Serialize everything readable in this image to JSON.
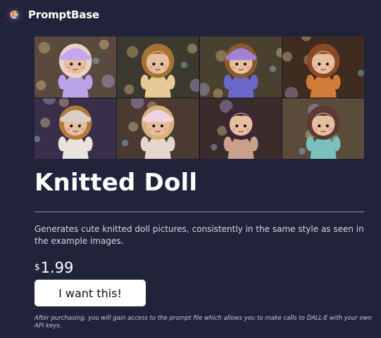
{
  "header": {
    "brand": "PromptBase",
    "logo_icon": "promptbase-brain-logo-icon"
  },
  "gallery": {
    "images": [
      {
        "name": "lavender-doll-image",
        "bg": "#5a4a3e",
        "body": "#b9a3e6",
        "hair": "#e8d2c8",
        "hat": "#c6a6ee"
      },
      {
        "name": "blonde-doll-image",
        "bg": "#3c3a2e",
        "body": "#e7c995",
        "hair": "#a77335",
        "hat": ""
      },
      {
        "name": "purple-hat-doll-image",
        "bg": "#4a4030",
        "body": "#6a67c9",
        "hair": "#8a5a2a",
        "hat": "#9e82d6"
      },
      {
        "name": "orange-doll-image",
        "bg": "#3e2c20",
        "body": "#d27c3a",
        "hair": "#8b4a25",
        "hat": ""
      },
      {
        "name": "beige-hat-doll-image",
        "bg": "#3a2f4a",
        "body": "#e9e3dc",
        "hair": "#b27a3c",
        "hat": "#d9d0c5"
      },
      {
        "name": "pink-hat-doll-image",
        "bg": "#4a3a32",
        "body": "#e3d6cc",
        "hair": "#d8b07a",
        "hat": "#f1d1e1"
      },
      {
        "name": "dark-hair-doll-image",
        "bg": "#3a2c2a",
        "body": "#caa08a",
        "hair": "#3d2735",
        "hat": ""
      },
      {
        "name": "teal-doll-image",
        "bg": "#5a4b3a",
        "body": "#7ac0bd",
        "hair": "#5a3a34",
        "hat": ""
      }
    ]
  },
  "product": {
    "title": "Knitted Doll",
    "description": "Generates cute knitted doll pictures, consistently in the same style as seen in the example images.",
    "currency": "$",
    "price": "1.99",
    "buy_label": "I want this!",
    "note": "After purchasing, you will gain access to the prompt file which allows you to make calls to DALL-E with your own API keys."
  }
}
